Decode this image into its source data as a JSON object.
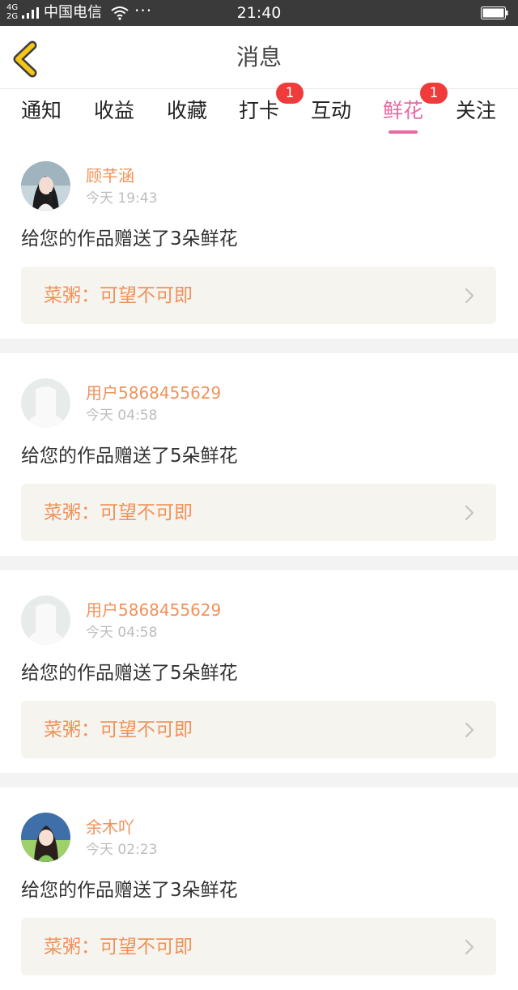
{
  "status_bar": {
    "network_top": "4G",
    "network_bottom": "2G",
    "carrier": "中国电信",
    "more": "···",
    "time": "21:40"
  },
  "header": {
    "title": "消息",
    "back_icon": "chevron-left-icon"
  },
  "tabs": [
    {
      "label": "通知"
    },
    {
      "label": "收益"
    },
    {
      "label": "收藏"
    },
    {
      "label": "打卡",
      "badge": "1"
    },
    {
      "label": "互动"
    },
    {
      "label": "鲜花",
      "badge": "1",
      "active": true
    },
    {
      "label": "关注"
    }
  ],
  "messages": [
    {
      "username": "顾芊涵",
      "time": "今天 19:43",
      "text": "给您的作品赠送了3朵鲜花",
      "work": "菜粥：可望不可即",
      "avatar": "photo-avatar"
    },
    {
      "username": "用户5868455629",
      "time": "今天 04:58",
      "text": "给您的作品赠送了5朵鲜花",
      "work": "菜粥：可望不可即",
      "avatar": "default-avatar"
    },
    {
      "username": "用户5868455629",
      "time": "今天 04:58",
      "text": "给您的作品赠送了5朵鲜花",
      "work": "菜粥：可望不可即",
      "avatar": "default-avatar"
    },
    {
      "username": "余木吖",
      "time": "今天 02:23",
      "text": "给您的作品赠送了3朵鲜花",
      "work": "菜粥：可望不可即",
      "avatar": "photo-avatar"
    }
  ],
  "colors": {
    "accent_pink": "#e86aa2",
    "name_orange": "#f0925a",
    "badge_red": "#f03b3b",
    "back_yellow": "#f5c518"
  }
}
